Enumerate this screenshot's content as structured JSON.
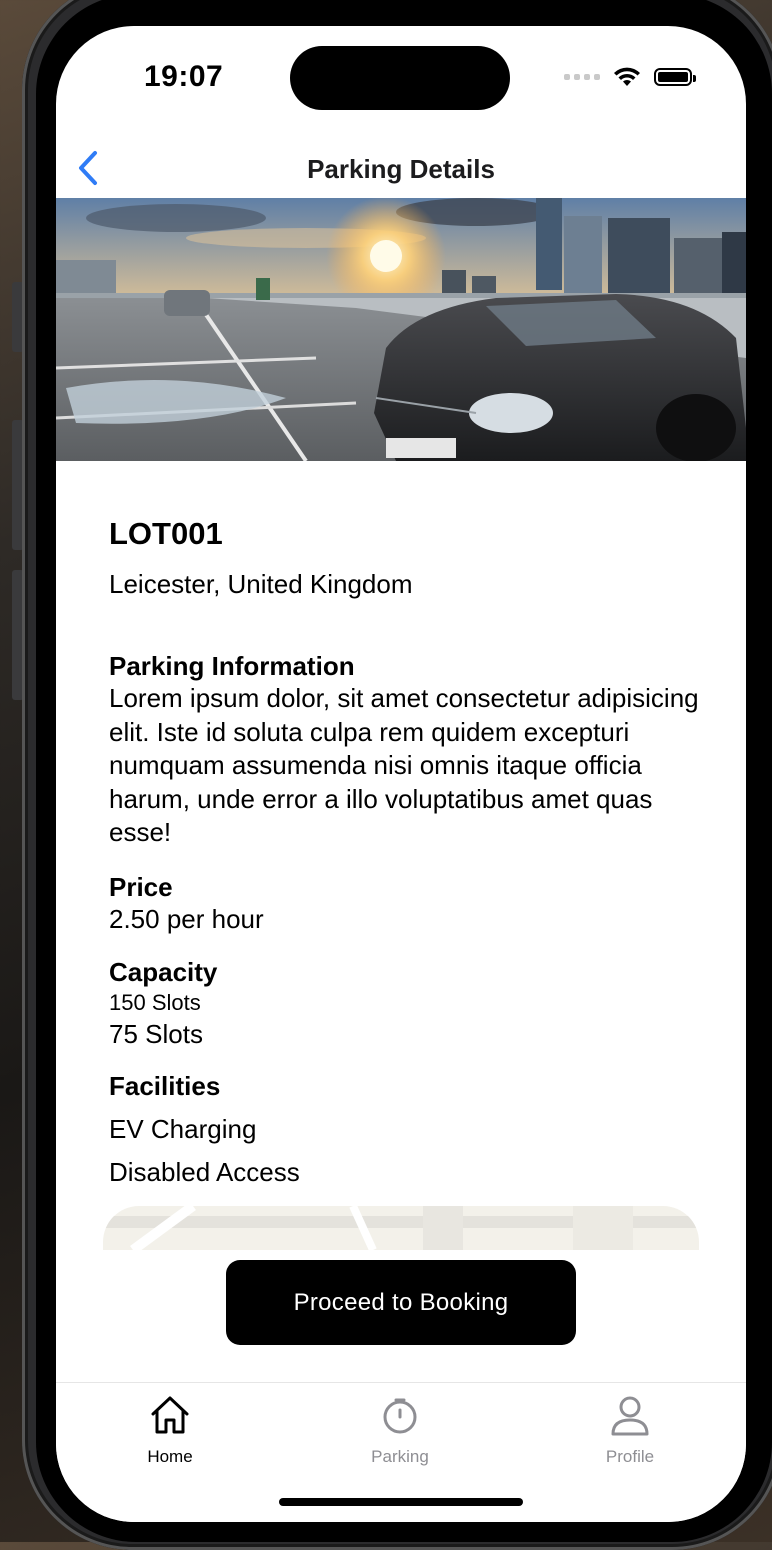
{
  "status_bar": {
    "time": "19:07"
  },
  "nav": {
    "title": "Parking Details",
    "back_icon": "chevron-left-icon"
  },
  "hero": {
    "icon": "parking-photo"
  },
  "lot": {
    "name": "LOT001",
    "location": "Leicester, United Kingdom"
  },
  "info": {
    "title": "Parking Information",
    "description": "Lorem ipsum dolor, sit amet consectetur adipisicing elit. Iste id soluta culpa rem quidem excepturi numquam assumenda nisi omnis itaque officia harum, unde error a illo voluptatibus amet quas esse!"
  },
  "price": {
    "title": "Price",
    "value": "2.50 per hour"
  },
  "capacity": {
    "title": "Capacity",
    "total": "150 Slots",
    "available": "75 Slots"
  },
  "facilities": {
    "title": "Facilities",
    "items": [
      "EV Charging",
      "Disabled Access"
    ]
  },
  "cta": {
    "label": "Proceed to Booking"
  },
  "tabs": [
    {
      "label": "Home",
      "icon": "home-icon",
      "active": true
    },
    {
      "label": "Parking",
      "icon": "timer-icon",
      "active": false
    },
    {
      "label": "Profile",
      "icon": "person-icon",
      "active": false
    }
  ],
  "colors": {
    "accent": "#2f7cf6",
    "cta_bg": "#000000",
    "inactive_tab": "#8e8e93"
  }
}
